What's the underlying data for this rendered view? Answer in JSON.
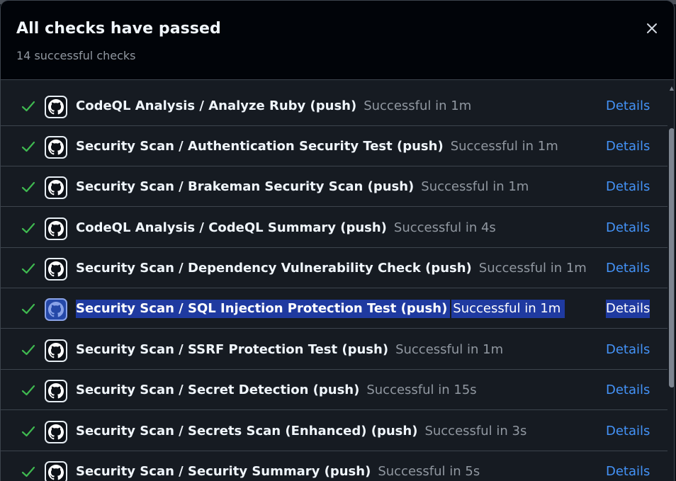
{
  "dialog": {
    "title": "All checks have passed",
    "subtitle": "14 successful checks",
    "close_label": "×"
  },
  "colors": {
    "success": "#3fb950",
    "link": "#4493f8",
    "selection": "#1f3aa0"
  },
  "checks": [
    {
      "name": "CodeQL Analysis / Analyze Ruby (push)",
      "status": "Successful in 1m",
      "details": "Details"
    },
    {
      "name": "Security Scan / Authentication Security Test (push)",
      "status": "Successful in 1m",
      "details": "Details"
    },
    {
      "name": "Security Scan / Brakeman Security Scan (push)",
      "status": "Successful in 1m",
      "details": "Details"
    },
    {
      "name": "CodeQL Analysis / CodeQL Summary (push)",
      "status": "Successful in 4s",
      "details": "Details"
    },
    {
      "name": "Security Scan / Dependency Vulnerability Check (push)",
      "status": "Successful in 1m",
      "details": "Details"
    },
    {
      "name": "Security Scan / SQL Injection Protection Test (push)",
      "status": "Successful in 1m",
      "details": "Details",
      "selected": true
    },
    {
      "name": "Security Scan / SSRF Protection Test (push)",
      "status": "Successful in 1m",
      "details": "Details"
    },
    {
      "name": "Security Scan / Secret Detection (push)",
      "status": "Successful in 15s",
      "details": "Details"
    },
    {
      "name": "Security Scan / Secrets Scan (Enhanced) (push)",
      "status": "Successful in 3s",
      "details": "Details"
    },
    {
      "name": "Security Scan / Security Summary (push)",
      "status": "Successful in 5s",
      "details": "Details"
    }
  ],
  "icons": {
    "check": "check-icon",
    "provider": "github-icon",
    "close": "close-icon"
  }
}
